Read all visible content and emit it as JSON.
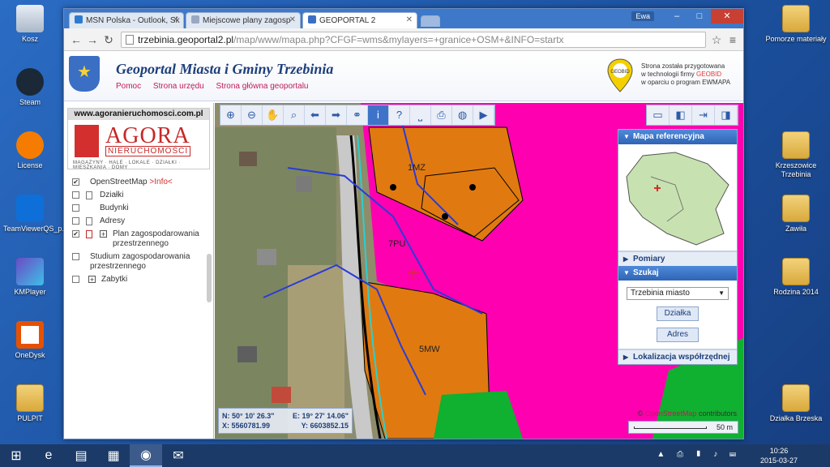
{
  "desktop": {
    "left_icons": [
      {
        "label": "Kosz",
        "icon": "recycle-bin-icon"
      },
      {
        "label": "Steam",
        "icon": "steam-icon"
      },
      {
        "label": "License",
        "icon": "avast-icon"
      },
      {
        "label": "TeamViewerQS_p...",
        "icon": "teamviewer-icon"
      },
      {
        "label": "KMPlayer",
        "icon": "kmplayer-icon"
      },
      {
        "label": "OneDysk",
        "icon": "onedrive-icon"
      },
      {
        "label": "PULPIT",
        "icon": "folder-icon"
      }
    ],
    "right_icons": [
      {
        "label": "Pomorze materiały",
        "icon": "folder-icon"
      },
      {
        "label": "Krzeszowice Trzebinia",
        "icon": "folder-icon"
      },
      {
        "label": "Zawiła",
        "icon": "folder-icon"
      },
      {
        "label": "Rodzina 2014",
        "icon": "folder-icon"
      },
      {
        "label": "Działka Brzeska",
        "icon": "folder-icon"
      }
    ]
  },
  "browser": {
    "tabs": [
      {
        "title": "MSN Polska - Outlook, Sk",
        "color": "#2d7bd1"
      },
      {
        "title": "Miejscowe plany zagosp",
        "color": "#9aa8c2"
      },
      {
        "title": "GEOPORTAL 2",
        "color": "#3b6fc4"
      }
    ],
    "user": "Ewa",
    "url_host": "trzebinia.geoportal2.pl",
    "url_path": "/map/www/mapa.php?CFGF=wms&mylayers=+granice+OSM+&INFO=startx"
  },
  "site": {
    "title": "Geoportal Miasta i Gminy Trzebinia",
    "links": [
      "Pomoc",
      "Strona urzędu",
      "Strona główna geoportalu"
    ],
    "powered_by": [
      "Strona została przygotowana",
      "w technologii firmy",
      "GEOBID",
      "w oparciu o program EWMAPA"
    ],
    "geobid_label": "GEOBID"
  },
  "sidebar": {
    "banner_url": "www.agoranieruchomosci.com.pl",
    "banner_name": "AGORA",
    "banner_sub": "NIERUCHOMOŚCI",
    "banner_tagline": "MAGAZYNY · HALE · LOKALE · DZIAŁKI · MIESZKANIA · DOMY",
    "layers": [
      {
        "label": "OpenStreetMap",
        "info": ">Info<",
        "checked": true
      },
      {
        "label": "Działki",
        "checked": false
      },
      {
        "label": "Budynki",
        "checked": false
      },
      {
        "label": "Adresy",
        "checked": false
      },
      {
        "label": "Plan zagospodarowania przestrzennego",
        "checked": true
      },
      {
        "label": "Studium zagospodarowania przestrzennego",
        "checked": false
      },
      {
        "label": "Zabytki",
        "checked": false
      }
    ]
  },
  "map": {
    "zones": [
      "1MZ",
      "7PU",
      "5MW"
    ],
    "coords": {
      "n": "N: 50° 10' 26.3\"",
      "e": "E: 19° 27' 14.06\"",
      "x": "X: 5560781.99",
      "y": "Y: 6603852.15"
    },
    "credit_link": "OpenStreetMap",
    "credit_rest": "contributors",
    "scale_label": "50 m",
    "colors": {
      "pink": "#ff00b0",
      "orange": "#e07a10",
      "green": "#10b030",
      "road": "#c9c9c9"
    }
  },
  "right_panel": {
    "minimap_title": "Mapa referencyjna",
    "measure_title": "Pomiary",
    "search_title": "Szukaj",
    "search_select": "Trzebinia miasto",
    "search_buttons": [
      "Działka",
      "Adres"
    ],
    "coord_title": "Lokalizacja współrzędnej"
  },
  "taskbar": {
    "time": "10:26",
    "date": "2015-03-27"
  }
}
